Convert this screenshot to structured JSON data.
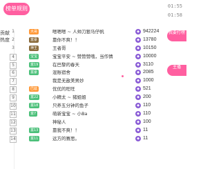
{
  "header": {
    "pill_label": "榜单规则",
    "timestamps": [
      "01:55",
      "01:58"
    ]
  },
  "side_tabs": [
    "贡献",
    "热度"
  ],
  "right_buttons": [
    "我要打榜",
    "主播"
  ],
  "rows": [
    {
      "rank": "1",
      "badge": "大哥",
      "name": "嗯嗯嗯 ~ 人帅刀狠马仔帆",
      "score": "942224",
      "coin": "◆"
    },
    {
      "rank": "2",
      "badge": "富豪",
      "name": "靠你不爽！！",
      "score": "13780",
      "coin": "◆"
    },
    {
      "rank": "3",
      "badge": "神王",
      "name": "王者哥",
      "score": "10150",
      "coin": "◆"
    },
    {
      "rank": "4",
      "badge": "宝宝",
      "name": "宝宝平安 ~ 赞赞赞哦，当作情",
      "score": "10000",
      "coin": "◆"
    },
    {
      "rank": "5",
      "badge": "富19",
      "name": "在巴黎的春天",
      "score": "3110",
      "coin": "◆"
    },
    {
      "rank": "6",
      "badge": "富豪",
      "name": "混账宿舍",
      "score": "2085",
      "coin": "◆"
    },
    {
      "rank": "7",
      "badge": "",
      "name": "我是无敌美男妙",
      "score": "1000",
      "coin": "◆"
    },
    {
      "rank": "8",
      "badge": "巴兹",
      "name": "优优的旺旺",
      "score": "521",
      "coin": "◆"
    },
    {
      "rank": "9",
      "badge": "富22",
      "name": "小精太 ~ 猪姐姐",
      "score": "200",
      "coin": "◆"
    },
    {
      "rank": "10",
      "badge": "富18",
      "name": "只养五分钟的鱼子",
      "score": "110",
      "coin": "◆"
    },
    {
      "rank": "11",
      "badge": "富7",
      "name": "萌新宝宝 ~ 小Ba",
      "score": "110",
      "coin": "◆"
    },
    {
      "rank": "12",
      "badge": "",
      "name": "神秘人",
      "score": "100",
      "coin": "◆"
    },
    {
      "rank": "13",
      "badge": "富13",
      "name": "靠我不爽！！",
      "score": "11",
      "coin": "◆"
    },
    {
      "rank": "14",
      "badge": "富11",
      "name": "远方的赛思。",
      "score": "11",
      "coin": "◆"
    }
  ]
}
